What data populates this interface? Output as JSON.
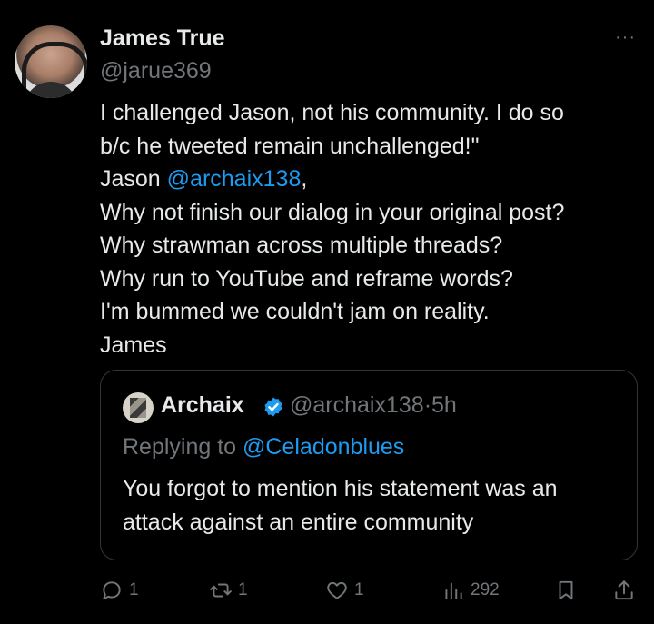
{
  "tweet": {
    "author_name": "James True",
    "author_handle": "@jarue369",
    "more_label": "···",
    "lines": [
      "I challenged Jason, not his community. I do so",
      "b/c he tweeted remain unchallenged!\"",
      "Jason ",
      "Why not finish our dialog in your original post?",
      "Why strawman across multiple threads?",
      "Why run to YouTube and reframe words?",
      "I'm bummed we couldn't jam on reality.",
      "James"
    ],
    "mention": "@archaix138",
    "mention_suffix": ","
  },
  "quote": {
    "name": "Archaix",
    "handle": "@archaix138",
    "separator": "·",
    "time": "5h",
    "replying_label": "Replying to ",
    "replying_to": "@Celadonblues",
    "text_line1": "You forgot to mention his statement was an",
    "text_line2": "attack against an entire community"
  },
  "actions": {
    "replies": "1",
    "reposts": "1",
    "likes": "1",
    "views": "292"
  },
  "colors": {
    "accent": "#1d9bf0",
    "muted": "#71767b",
    "text": "#e7e9ea",
    "background": "#000000"
  }
}
